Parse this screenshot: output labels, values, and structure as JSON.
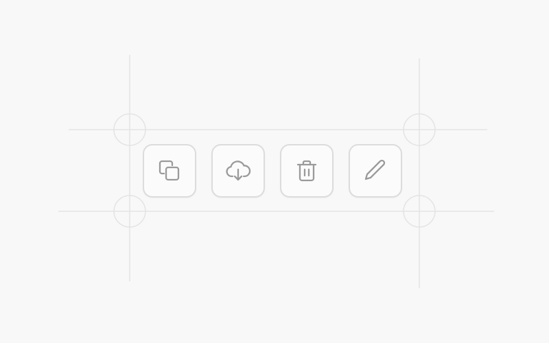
{
  "colors": {
    "background": "#f8f8f8",
    "guide_line": "#e4e4e4",
    "button_border": "#dcdcdc",
    "icon_stroke": "#9a9a9a"
  },
  "toolbar": {
    "buttons": [
      {
        "name": "copy",
        "icon": "copy-icon"
      },
      {
        "name": "download",
        "icon": "cloud-download-icon"
      },
      {
        "name": "delete",
        "icon": "trash-icon"
      },
      {
        "name": "edit",
        "icon": "pencil-icon"
      }
    ]
  }
}
